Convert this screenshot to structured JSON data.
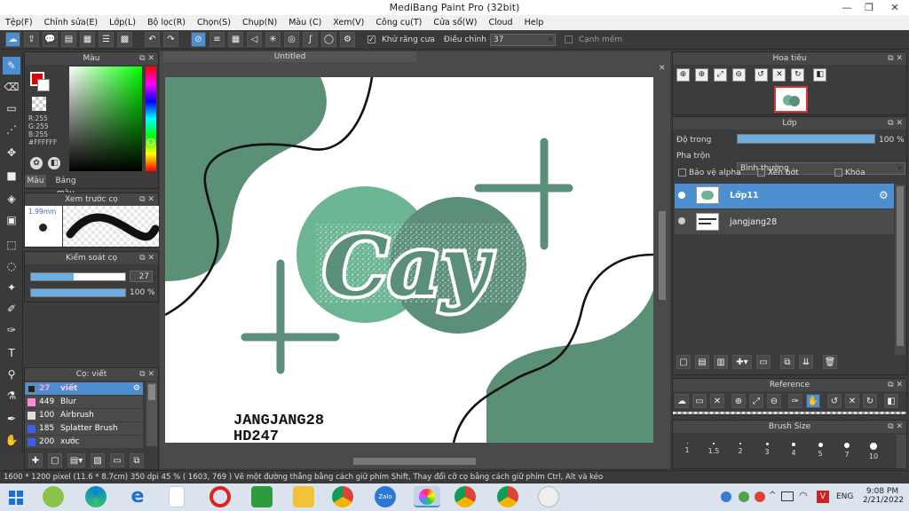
{
  "titlebar": {
    "title": "MediBang Paint Pro (32bit)",
    "min": "—",
    "max": "❐",
    "close": "✕"
  },
  "menu": [
    "Tệp(F)",
    "Chỉnh sửa(E)",
    "Lớp(L)",
    "Bộ lọc(R)",
    "Chọn(S)",
    "Chụp(N)",
    "Màu (C)",
    "Xem(V)",
    "Công cụ(T)",
    "Cửa sổ(W)",
    "Cloud",
    "Help"
  ],
  "toolbar": {
    "antialias_label": "Khử răng cưa",
    "adjust_label": "Điều chỉnh",
    "adjust_value": "37",
    "soft_edge_label": "Cạnh mềm"
  },
  "color_panel": {
    "title": "Màu",
    "r": "R:255",
    "g": "G:255",
    "b": "B:255",
    "hex": "#FFFFFF",
    "tab_color": "Màu",
    "tab_palette": "Bảng màu"
  },
  "brush_preview": {
    "title": "Xem trước cọ",
    "size": "1.99mm"
  },
  "brush_control": {
    "title": "Kiểm soát cọ",
    "size_value": "27",
    "opacity_value": "100 %",
    "size_fraction": 0.45,
    "opacity_fraction": 1.0
  },
  "brush_list": {
    "title": "Cọ: viết",
    "items": [
      {
        "size": "27",
        "name": "viết",
        "color": "#222222",
        "selected": true
      },
      {
        "size": "449",
        "name": "Blur",
        "color": "#ff8ad8",
        "selected": false
      },
      {
        "size": "100",
        "name": "Airbrush",
        "color": "#dddddd",
        "selected": false
      },
      {
        "size": "185",
        "name": "Splatter Brush",
        "color": "#3c5ee8",
        "selected": false
      },
      {
        "size": "200",
        "name": "xước",
        "color": "#3c5ee8",
        "selected": false
      }
    ]
  },
  "canvas": {
    "tab": "Untitled",
    "text_line1": "JANGJANG28",
    "text_line2": "HD247",
    "art_word": "Cay"
  },
  "navigator": {
    "title": "Hoa tiêu"
  },
  "layers": {
    "title": "Lớp",
    "opacity_label": "Độ trong",
    "opacity_value": "100 %",
    "blend_label": "Pha trộn",
    "blend_value": "Bình thường",
    "protect_alpha": "Bảo vệ alpha",
    "clipping": "Xén bớt",
    "lock": "Khóa",
    "items": [
      {
        "name": "Lớp11",
        "selected": true
      },
      {
        "name": "jangjang28",
        "selected": false
      }
    ]
  },
  "reference": {
    "title": "Reference"
  },
  "brush_size": {
    "title": "Brush Size",
    "sizes": [
      "1",
      "1.5",
      "2",
      "3",
      "4",
      "5",
      "7",
      "10"
    ]
  },
  "status": {
    "text": "1600 * 1200 pixel   (11.6 * 8.7cm)   350 dpi   45 %   ( 1603, 769 )   Vẽ một đường thẳng bằng cách giữ phím Shift, Thay đổi cỡ cọ bằng cách giữ phím Ctrl, Alt và kéo"
  },
  "taskbar": {
    "lang": "ENG",
    "time": "9:08 PM",
    "date": "2/21/2022",
    "zalo": "Zalo"
  },
  "colors": {
    "accent": "#4b8fd0",
    "art_dark": "#5a9076",
    "art_light": "#6cb592",
    "art_mid": "#5c8f79"
  }
}
